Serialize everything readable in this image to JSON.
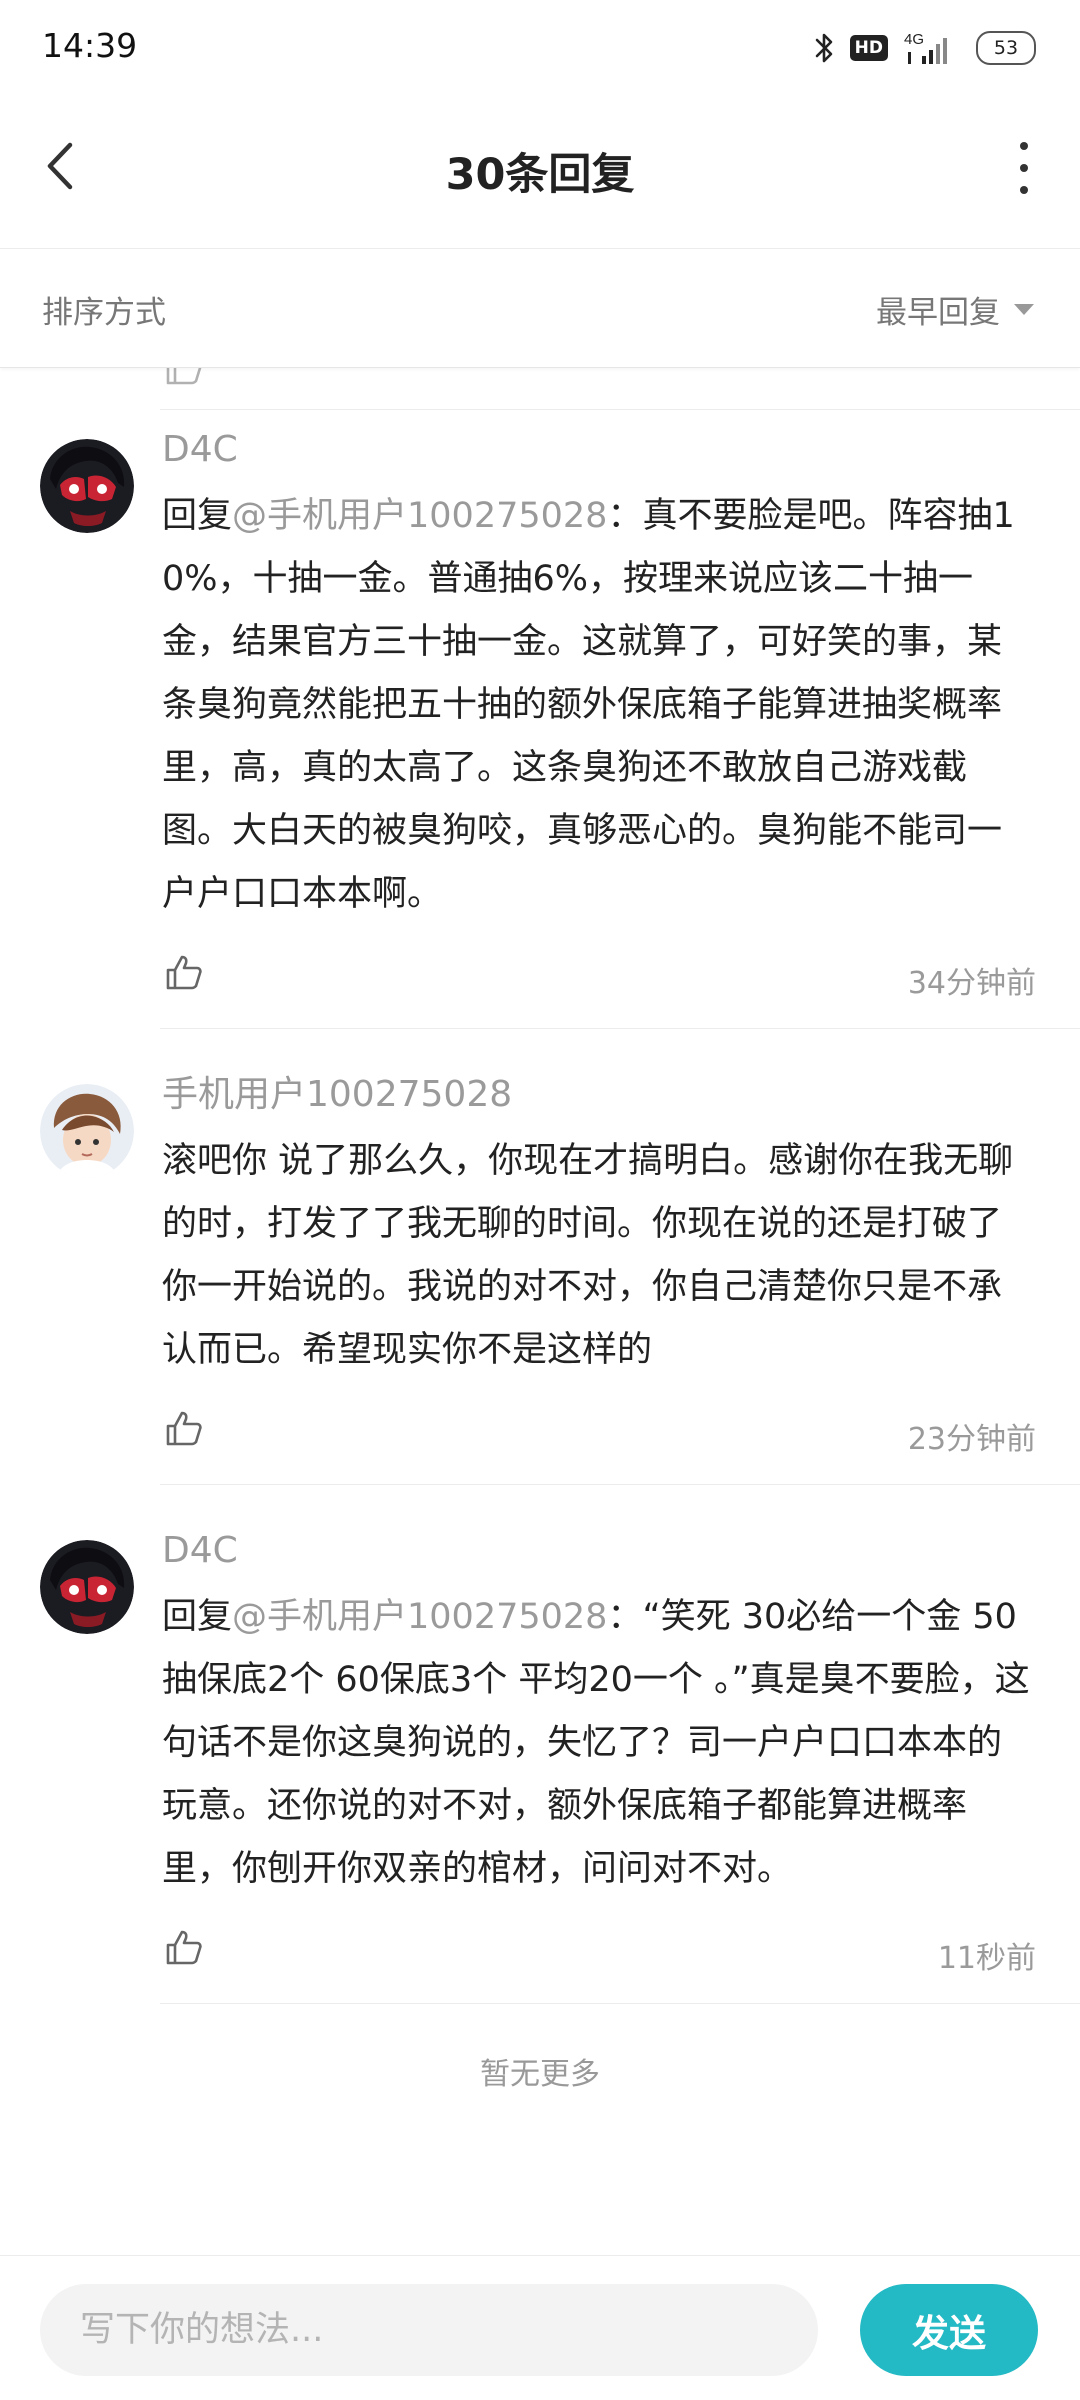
{
  "status_bar": {
    "time": "14:39",
    "network": "4G",
    "hd": "HD",
    "battery": "53"
  },
  "nav": {
    "title": "30条回复"
  },
  "sort": {
    "label": "排序方式",
    "selected": "最早回复"
  },
  "comments": [
    {
      "username": "D4C",
      "reply_prefix": "回复",
      "mention": "@手机用户100275028",
      "text": "：真不要脸是吧。阵容抽10%，十抽一金。普通抽6%，按理来说应该二十抽一金，结果官方三十抽一金。这就算了，可好笑的事，某条臭狗竟然能把五十抽的额外保底箱子能算进抽奖概率里，高，真的太高了。这条臭狗还不敢放自己游戏截图。大白天的被臭狗咬，真够恶心的。臭狗能不能司一户户口口本本啊。",
      "time": "34分钟前",
      "avatar_icon": "avatar-masked-character"
    },
    {
      "username": "手机用户100275028",
      "text": "滚吧你 说了那么久，你现在才搞明白。感谢你在我无聊的时，打发了了我无聊的时间。你现在说的还是打破了你一开始说的。我说的对不对，你自己清楚你只是不承认而已。希望现实你不是这样的",
      "time": "23分钟前",
      "avatar_icon": "avatar-anime-boy"
    },
    {
      "username": "D4C",
      "reply_prefix": "回复",
      "mention": "@手机用户100275028",
      "text": "：“笑死 30必给一个金 50抽保底2个 60保底3个 平均20一个 。”真是臭不要脸，这句话不是你这臭狗说的，失忆了？司一户户口口本本的玩意。还你说的对不对，额外保底箱子都能算进概率里，你刨开你双亲的棺材，问问对不对。",
      "time": "11秒前",
      "avatar_icon": "avatar-masked-character"
    }
  ],
  "no_more": "暂无更多",
  "composer": {
    "placeholder": "写下你的想法...",
    "send_label": "发送"
  },
  "colors": {
    "accent": "#23b9c5",
    "muted_text": "#9a9a9a",
    "divider": "#ececec"
  },
  "icons": [
    "back-arrow-icon",
    "more-vertical-icon",
    "bluetooth-icon",
    "signal-icon",
    "battery-icon",
    "caret-down-icon",
    "thumb-up-icon"
  ]
}
